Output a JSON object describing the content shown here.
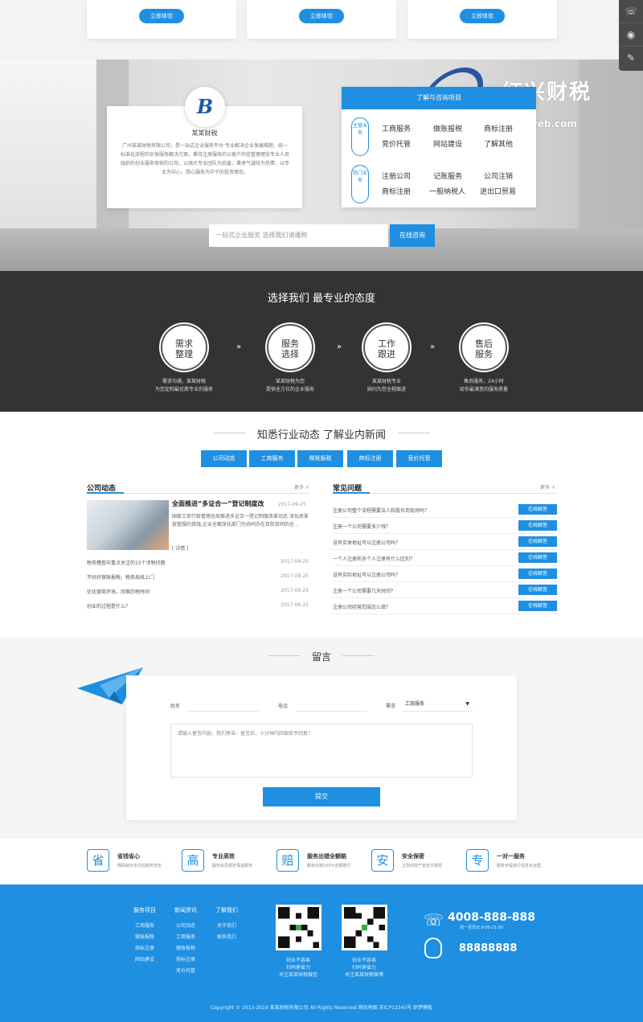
{
  "top_cards": {
    "button_label": "立即体验"
  },
  "floatbar": {
    "icons": [
      "phone-icon",
      "qq-icon",
      "edit-icon"
    ]
  },
  "intro": {
    "name": "某某财税",
    "text": "广州某某财税有限公司，是一站式企业服务平台·专业解决企业发展难题，统一标准化流程的实体服务解决方案。秉持注册服务的以客户的信管理理念专业人员组织的创业服务审核的公司，以强大专业团队为后盾，秉承气诚待为热情，以专业为中心，用心服务为中于的投资理念。"
  },
  "services": {
    "header": "了解与咨询项目",
    "group1_label": "主营业务",
    "group2_label": "热门业务",
    "group1": [
      "工商服务",
      "做账报税",
      "商标注册",
      "竞价托管",
      "网站建设",
      "了解其他"
    ],
    "group2": [
      "注册公司",
      "记账服务",
      "公司注销",
      "商标注册",
      "一般纳税人",
      "进出口贸易"
    ]
  },
  "brand": {
    "cn": "红兴财税",
    "en": "caishuiweb.com"
  },
  "search": {
    "placeholder": "一站式企业服务 选择我们请播称",
    "button": "在线咨询"
  },
  "choose": {
    "title": "选择我们  最专业的态度",
    "steps": [
      {
        "l1": "需求",
        "l2": "整理",
        "desc1": "需求沟通，某某财税",
        "desc2": "为您定制最优质专业的服务"
      },
      {
        "l1": "服务",
        "l2": "选择",
        "desc1": "某某财税为您",
        "desc2": "提供全方位的企业服务"
      },
      {
        "l1": "工作",
        "l2": "跟进",
        "desc1": "某某财税专业",
        "desc2": "顾问为您全程跟进"
      },
      {
        "l1": "售后",
        "l2": "服务",
        "desc1": "售后服务，24小时",
        "desc2": "给你最满意的服务质量"
      }
    ],
    "arrow": "»"
  },
  "news": {
    "title": "知悉行业动态  了解业内新闻",
    "tabs": [
      "公司动态",
      "工商服务",
      "做账报税",
      "商标注册",
      "竞价托管"
    ],
    "company": {
      "title": "公司动态",
      "more": "更多 +",
      "featured": {
        "title": "全面推进“多证合一”登记制度改",
        "date": "2017-09-25",
        "text": "国家工商行政管理总局推进多证合一登记制度改革动态 深化改革放管服的措施,企业全面深化部门为协同办在目前目同的全...",
        "more": "[ 详情 ]"
      },
      "items": [
        {
          "t": "税务稽查中重点关注的15个涉税问题",
          "d": "2017-09-25"
        },
        {
          "t": "不好好保账报税，税务局找上门",
          "d": "2017-09-25"
        },
        {
          "t": "优化营商环境，压缩办税时间",
          "d": "2017-09-25"
        },
        {
          "t": "创业的过程是什么？",
          "d": "2017-09-25"
        }
      ]
    },
    "faq": {
      "title": "常见问题",
      "more": "更多 +",
      "button": "在线解答",
      "items": [
        "注册公司整个流程需要法人和股东到现场吗？",
        "注册一个公司需要多少钱？",
        "没有实体地址可以注册公司吗？",
        "一个人注册和多个人注册有什么区别？",
        "没有实际地址可以注册公司吗？",
        "注册一个公司需要几天时间？",
        "注册公司经营范围怎么填？"
      ]
    }
  },
  "message": {
    "title": "留言",
    "name_label": "姓名",
    "phone_label": "电话",
    "need_label": "需求",
    "need_value": "工商服务",
    "textarea_placeholder": "请输入留言内容，我们承诺：留言后，十分钟内回拨给予回复！",
    "submit": "提交"
  },
  "features": [
    {
      "icon": "省",
      "t1": "省钱省心",
      "t2": "明码标价支付后服务安全"
    },
    {
      "icon": "高",
      "t1": "专业高效",
      "t2": "服务会员规定保证服务"
    },
    {
      "icon": "赔",
      "t1": "服务出错全额赔",
      "t2": "服务出错100%全额赔付"
    },
    {
      "icon": "安",
      "t1": "安全保密",
      "t2": "让您的财产安全又保密"
    },
    {
      "icon": "专",
      "t1": "一对一服务",
      "t2": "服务专程进行信息化运营"
    }
  ],
  "footer": {
    "col1": {
      "head": "服务项目",
      "links": [
        "工商服务",
        "做账报税",
        "商标注册",
        "网站建设"
      ]
    },
    "col2": {
      "head": "新闻资讯",
      "links": [
        "公司动态",
        "工商服务",
        "做账报税",
        "商标注册",
        "竞价托管"
      ]
    },
    "col3": {
      "head": "了解我们",
      "links": [
        "关于我们",
        "联系我们"
      ]
    },
    "qr1": [
      "创业不容易",
      "扫码更省力",
      "关注某某财税微信"
    ],
    "qr2": [
      "创业不容易",
      "扫码更省力",
      "关注某某财税微博"
    ],
    "phone": "4008-888-888",
    "phone_sub": "周一至周日 9:00-21:00",
    "qq": "88888888",
    "copyright": "Copyright © 2013-2019 某某财税有限公司  All Rights Reserved   网站地图   苏ICP12345号   织梦模板"
  }
}
